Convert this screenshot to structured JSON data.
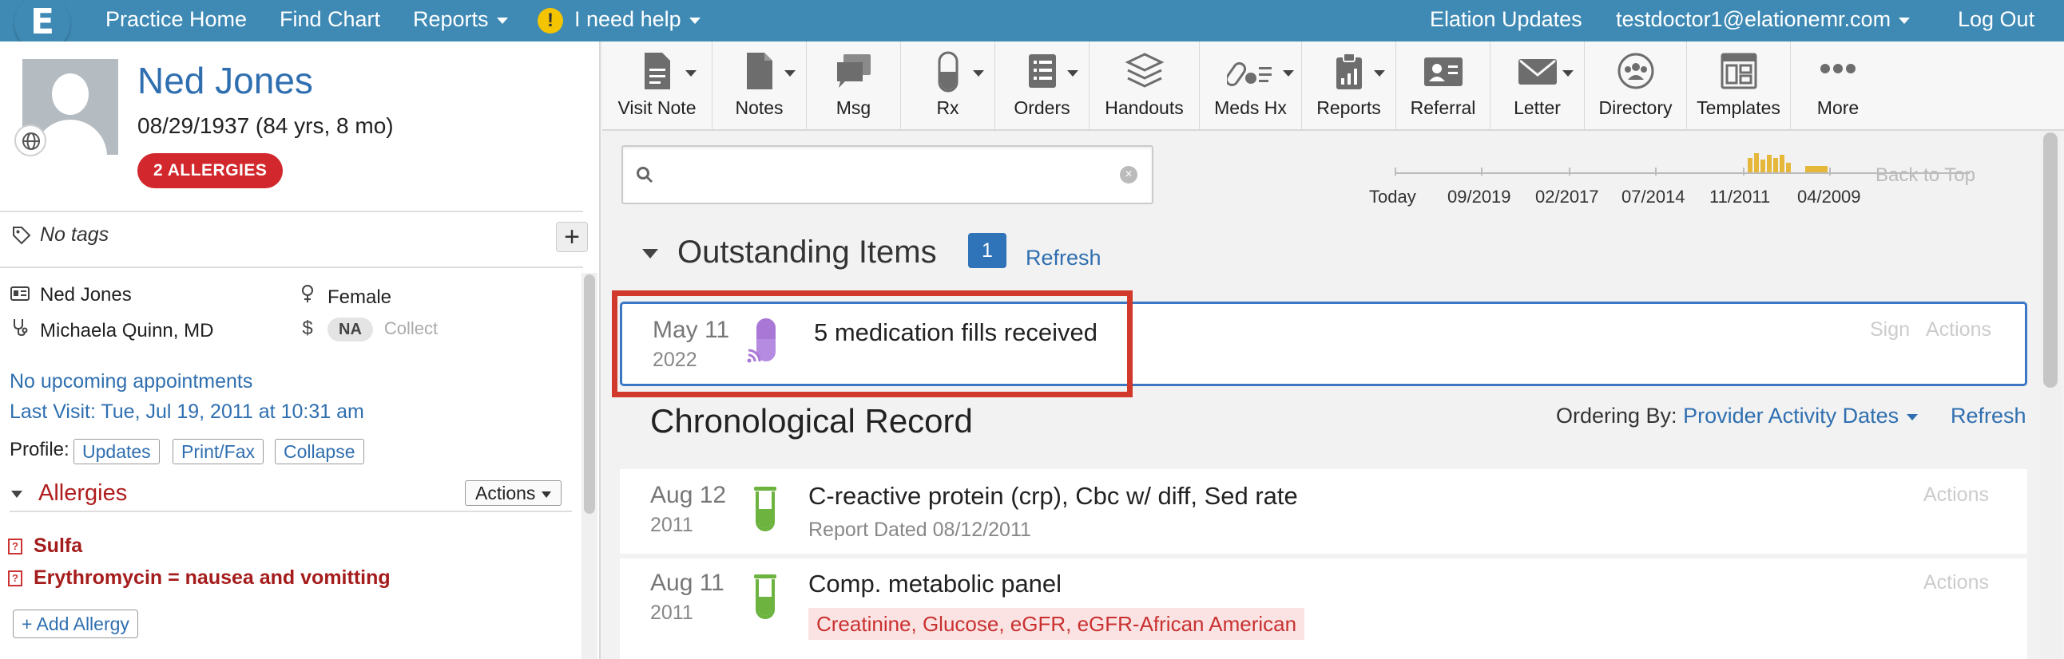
{
  "nav": {
    "logo": "E",
    "practice_home": "Practice Home",
    "find_chart": "Find Chart",
    "reports": "Reports",
    "help": "I need help",
    "elation_updates": "Elation Updates",
    "user_email": "testdoctor1@elationemr.com",
    "logout": "Log Out"
  },
  "patient": {
    "name": "Ned Jones",
    "dob": "08/29/1937 (84 yrs, 8 mo)",
    "allergy_badge": "2 ALLERGIES",
    "tags": "No tags",
    "legal_name": "Ned Jones",
    "sex": "Female",
    "provider": "Michaela Quinn, MD",
    "balance": "NA",
    "collect": "Collect",
    "no_appointments": "No upcoming appointments",
    "last_visit": "Last Visit: Tue, Jul 19, 2011 at 10:31 am",
    "profile_label": "Profile:",
    "profile_buttons": [
      "Updates",
      "Print/Fax",
      "Collapse"
    ]
  },
  "allergies": {
    "title": "Allergies",
    "actions": "Actions",
    "items": [
      "Sulfa",
      "Erythromycin = nausea and vomitting"
    ],
    "add": "+ Add Allergy"
  },
  "toolbar": {
    "tools": [
      {
        "label": "Visit Note",
        "icon": "visit-note-icon"
      },
      {
        "label": "Notes",
        "icon": "notes-icon"
      },
      {
        "label": "Msg",
        "icon": "message-icon"
      },
      {
        "label": "Rx",
        "icon": "rx-icon"
      },
      {
        "label": "Orders",
        "icon": "orders-icon"
      },
      {
        "label": "Handouts",
        "icon": "handouts-icon"
      },
      {
        "label": "Meds Hx",
        "icon": "meds-hx-icon"
      },
      {
        "label": "Reports",
        "icon": "reports-icon"
      },
      {
        "label": "Referral",
        "icon": "referral-icon"
      },
      {
        "label": "Letter",
        "icon": "letter-icon"
      },
      {
        "label": "Directory",
        "icon": "directory-icon"
      },
      {
        "label": "Templates",
        "icon": "templates-icon"
      },
      {
        "label": "More",
        "icon": "more-icon"
      }
    ]
  },
  "search": {
    "placeholder": ""
  },
  "timeline": {
    "labels": [
      "Today",
      "09/2019",
      "02/2017",
      "07/2014",
      "11/2011",
      "04/2009"
    ],
    "back_to_top": "Back to Top"
  },
  "outstanding": {
    "title": "Outstanding Items",
    "count": "1",
    "refresh": "Refresh",
    "item": {
      "date": "May 11",
      "year": "2022",
      "text": "5 medication fills received",
      "sign": "Sign",
      "actions": "Actions"
    }
  },
  "chronological": {
    "title": "Chronological Record",
    "ordering_label": "Ordering By:",
    "ordering_value": "Provider Activity Dates",
    "refresh": "Refresh",
    "records": [
      {
        "date": "Aug 12",
        "year": "2011",
        "title": "C-reactive protein (crp), Cbc w/ diff, Sed rate",
        "sub": "Report Dated 08/12/2011",
        "actions": "Actions"
      },
      {
        "date": "Aug 11",
        "year": "2011",
        "title": "Comp. metabolic panel",
        "tags": "Creatinine, Glucose, eGFR, eGFR-African American",
        "actions": "Actions"
      }
    ]
  },
  "colors": {
    "nav_bg": "#3e8ab5",
    "link": "#2f6fb0",
    "allergy_red": "#d2272c",
    "highlight_red": "#d0392b",
    "card_border": "#3b77c5",
    "lab_green": "#6cb33f",
    "med_purple": "#a978d6"
  }
}
